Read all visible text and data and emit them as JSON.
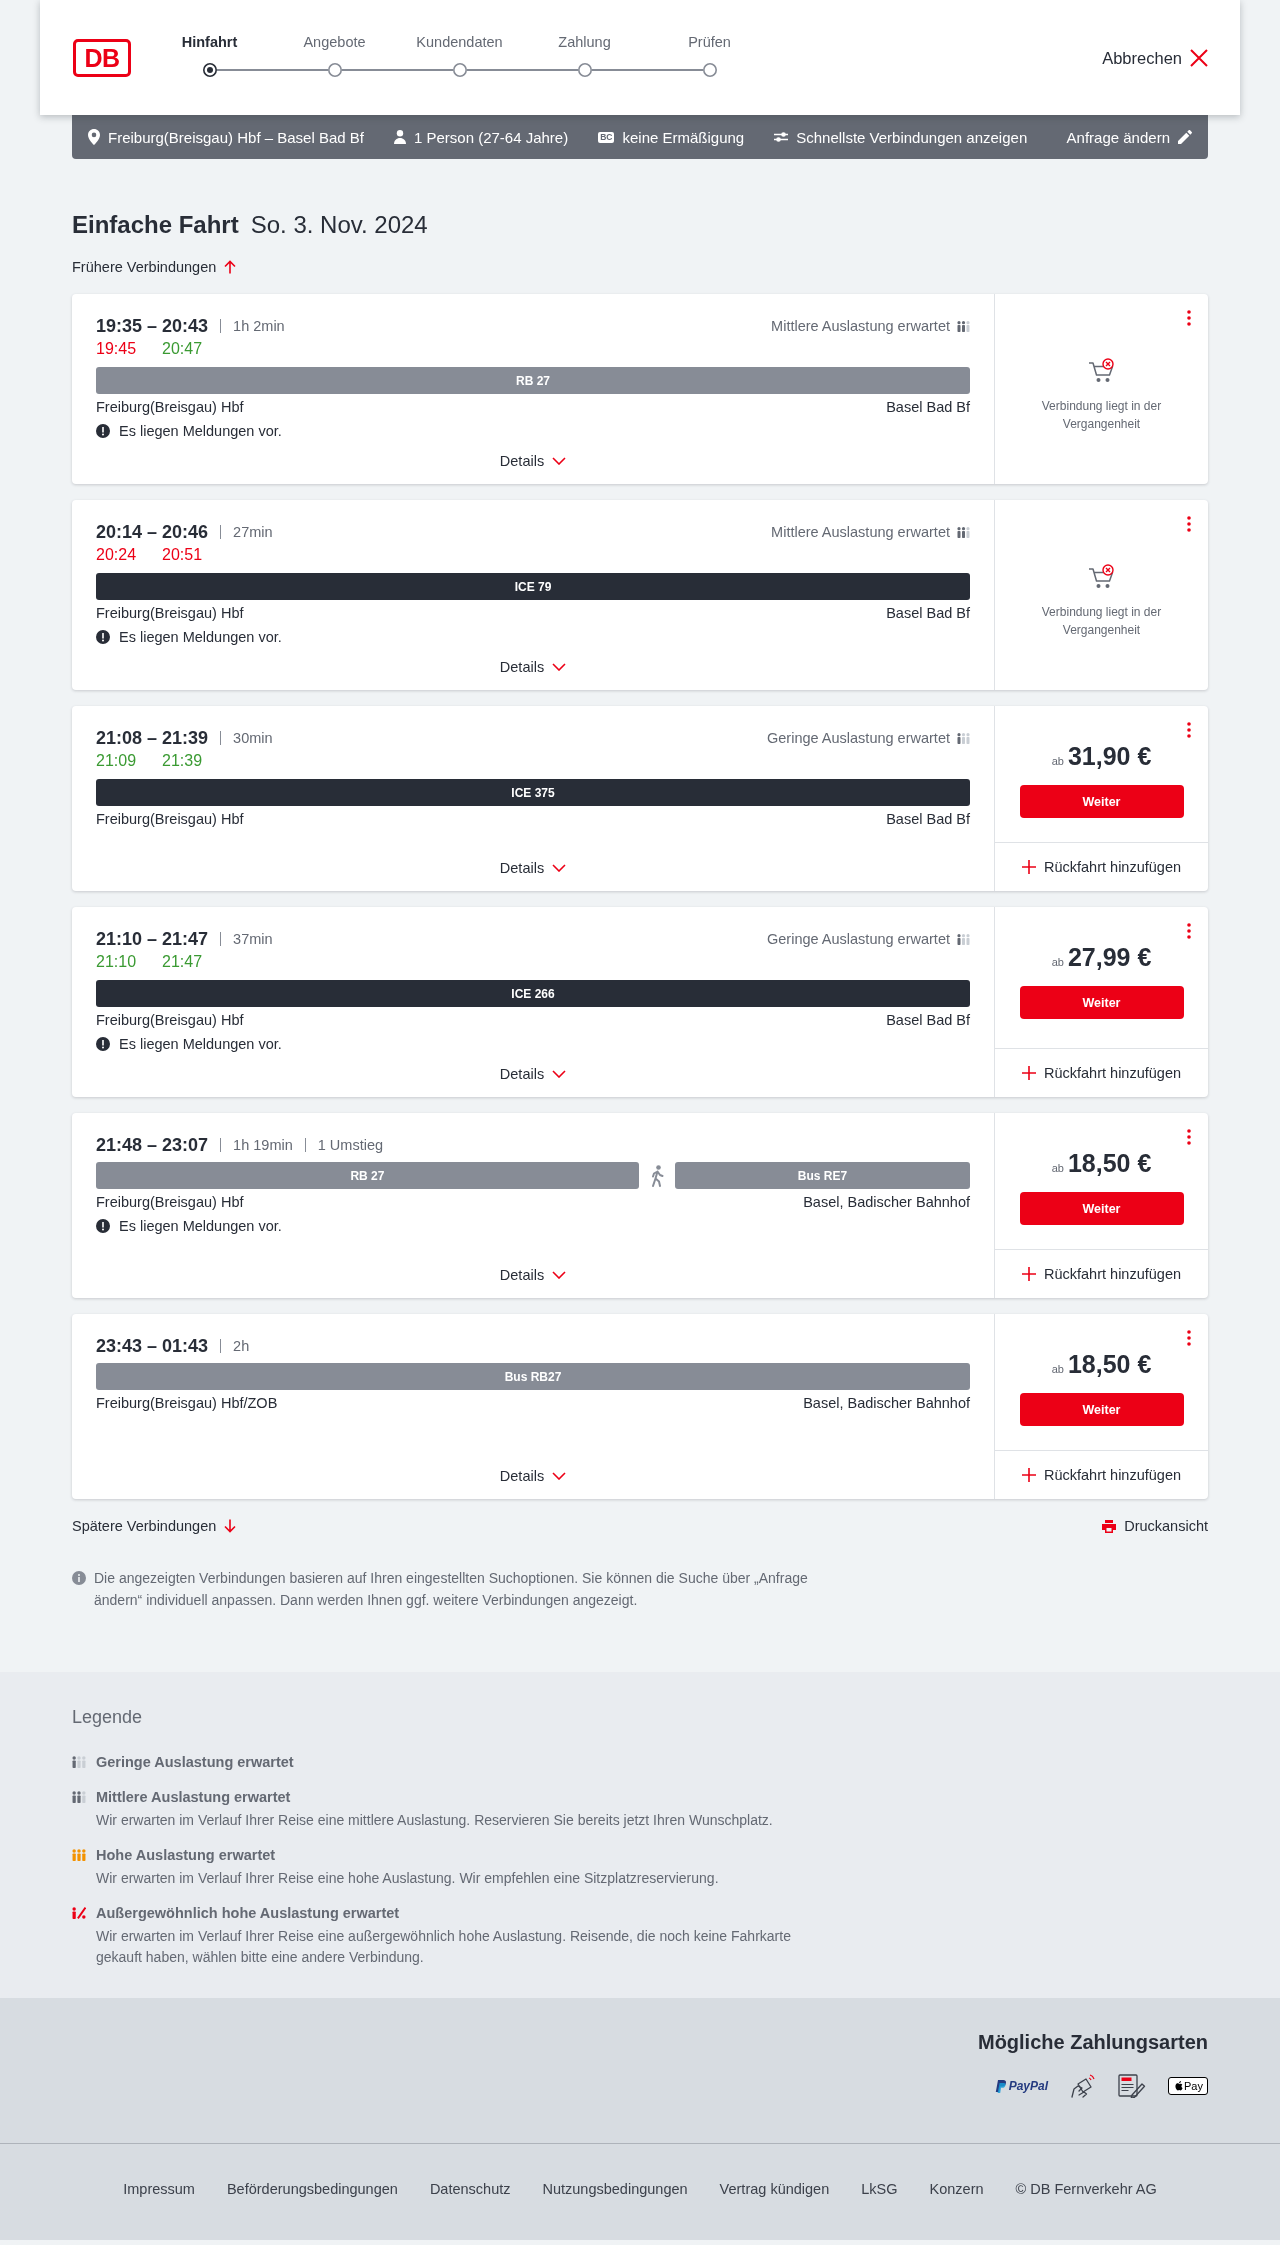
{
  "header": {
    "logo": "DB",
    "steps": [
      {
        "label": "Hinfahrt",
        "selected": true
      },
      {
        "label": "Angebote",
        "selected": false
      },
      {
        "label": "Kundendaten",
        "selected": false
      },
      {
        "label": "Zahlung",
        "selected": false
      },
      {
        "label": "Prüfen",
        "selected": false
      }
    ],
    "cancel": "Abbrechen"
  },
  "search_summary": {
    "items": [
      {
        "kind": "route",
        "text": "Freiburg(Breisgau) Hbf – Basel Bad Bf"
      },
      {
        "kind": "travellers",
        "text": "1 Person (27-64 Jahre)"
      },
      {
        "kind": "discount",
        "badge": "BC",
        "text": "keine Ermäßigung"
      },
      {
        "kind": "options",
        "text": "Schnellste Verbindungen anzeigen"
      }
    ],
    "edit": "Anfrage ändern"
  },
  "heading": {
    "title": "Einfache Fahrt",
    "date": "So. 3. Nov. 2024"
  },
  "earlier": "Frühere Verbindungen",
  "connections": [
    {
      "times": "19:35 – 20:43",
      "duration": "1h 2min",
      "realtime": [
        {
          "time": "19:45",
          "delayed": true
        },
        {
          "time": "20:47",
          "delayed": false
        }
      ],
      "occupancy": {
        "kind": "medium",
        "label": "Mittlere Auslastung erwartet"
      },
      "segments": [
        {
          "kind": "regional",
          "label": "RB 27"
        }
      ],
      "from": "Freiburg(Breisgau) Hbf",
      "to": "Basel Bad Bf",
      "message": "Es liegen Meldungen vor.",
      "details": "Details",
      "offer": {
        "kind": "past",
        "text": "Verbindung liegt in der Vergangenheit"
      }
    },
    {
      "times": "20:14 – 20:46",
      "duration": "27min",
      "realtime": [
        {
          "time": "20:24",
          "delayed": true
        },
        {
          "time": "20:51",
          "delayed": true
        }
      ],
      "occupancy": {
        "kind": "medium",
        "label": "Mittlere Auslastung erwartet"
      },
      "segments": [
        {
          "kind": "longdistance",
          "label": "ICE 79"
        }
      ],
      "from": "Freiburg(Breisgau) Hbf",
      "to": "Basel Bad Bf",
      "message": "Es liegen Meldungen vor.",
      "details": "Details",
      "offer": {
        "kind": "past",
        "text": "Verbindung liegt in der Vergangenheit"
      }
    },
    {
      "times": "21:08 – 21:39",
      "duration": "30min",
      "realtime": [
        {
          "time": "21:09",
          "delayed": false
        },
        {
          "time": "21:39",
          "delayed": false
        }
      ],
      "occupancy": {
        "kind": "low",
        "label": "Geringe Auslastung erwartet"
      },
      "segments": [
        {
          "kind": "longdistance",
          "label": "ICE 375"
        }
      ],
      "from": "Freiburg(Breisgau) Hbf",
      "to": "Basel Bad Bf",
      "details": "Details",
      "offer": {
        "kind": "price",
        "prefix": "ab",
        "price": "31,90 €",
        "button": "Weiter",
        "return_trip": "Rückfahrt hinzufügen"
      }
    },
    {
      "times": "21:10 – 21:47",
      "duration": "37min",
      "realtime": [
        {
          "time": "21:10",
          "delayed": false
        },
        {
          "time": "21:47",
          "delayed": false
        }
      ],
      "occupancy": {
        "kind": "low",
        "label": "Geringe Auslastung erwartet"
      },
      "segments": [
        {
          "kind": "longdistance",
          "label": "ICE 266"
        }
      ],
      "from": "Freiburg(Breisgau) Hbf",
      "to": "Basel Bad Bf",
      "message": "Es liegen Meldungen vor.",
      "details": "Details",
      "offer": {
        "kind": "price",
        "prefix": "ab",
        "price": "27,99 €",
        "button": "Weiter",
        "return_trip": "Rückfahrt hinzufügen"
      }
    },
    {
      "times": "21:48 – 23:07",
      "duration": "1h 19min",
      "transfers": "1 Umstieg",
      "segments": [
        {
          "kind": "regional",
          "label": "RB 27"
        },
        {
          "kind": "walk"
        },
        {
          "kind": "regional",
          "label": "Bus RE7"
        }
      ],
      "from": "Freiburg(Breisgau) Hbf",
      "to": "Basel, Badischer Bahnhof",
      "message": "Es liegen Meldungen vor.",
      "details": "Details",
      "offer": {
        "kind": "price",
        "prefix": "ab",
        "price": "18,50 €",
        "button": "Weiter",
        "return_trip": "Rückfahrt hinzufügen"
      }
    },
    {
      "times": "23:43 – 01:43",
      "duration": "2h",
      "segments": [
        {
          "kind": "regional",
          "label": "Bus RB27"
        }
      ],
      "from": "Freiburg(Breisgau) Hbf/ZOB",
      "to": "Basel, Badischer Bahnhof",
      "details": "Details",
      "offer": {
        "kind": "price",
        "prefix": "ab",
        "price": "18,50 €",
        "button": "Weiter",
        "return_trip": "Rückfahrt hinzufügen"
      }
    }
  ],
  "later": "Spätere Verbindungen",
  "print": "Druckansicht",
  "info": "Die angezeigten Verbindungen basieren auf Ihren eingestellten Suchoptionen. Sie können die Suche über „Anfrage ändern“ individuell anpassen. Dann werden Ihnen ggf. weitere Verbindungen angezeigt.",
  "legend": {
    "title": "Legende",
    "items": [
      {
        "kind": "low",
        "title": "Geringe Auslastung erwartet"
      },
      {
        "kind": "medium",
        "title": "Mittlere Auslastung erwartet",
        "text": "Wir erwarten im Verlauf Ihrer Reise eine mittlere Auslastung. Reservieren Sie bereits jetzt Ihren Wunschplatz."
      },
      {
        "kind": "high",
        "title": "Hohe Auslastung erwartet",
        "text": "Wir erwarten im Verlauf Ihrer Reise eine hohe Auslastung. Wir empfehlen eine Sitzplatzreservierung."
      },
      {
        "kind": "extreme",
        "title": "Außergewöhnlich hohe Auslastung erwartet",
        "text": "Wir erwarten im Verlauf Ihrer Reise eine außergewöhnlich hohe Auslastung. Reisende, die noch keine Fahrkarte gekauft haben, wählen bitte eine andere Verbindung."
      }
    ]
  },
  "payment": {
    "title": "Mögliche Zahlungsarten",
    "methods": [
      {
        "kind": "paypal",
        "label": "PayPal"
      },
      {
        "kind": "contactless"
      },
      {
        "kind": "sepa"
      },
      {
        "kind": "applepay",
        "label": "Pay"
      }
    ]
  },
  "footer": {
    "links": [
      "Impressum",
      "Beförderungsbedingungen",
      "Datenschutz",
      "Nutzungsbedingungen",
      "Vertrag kündigen",
      "LkSG",
      "Konzern"
    ],
    "copyright": "© DB Fernverkehr AG"
  }
}
